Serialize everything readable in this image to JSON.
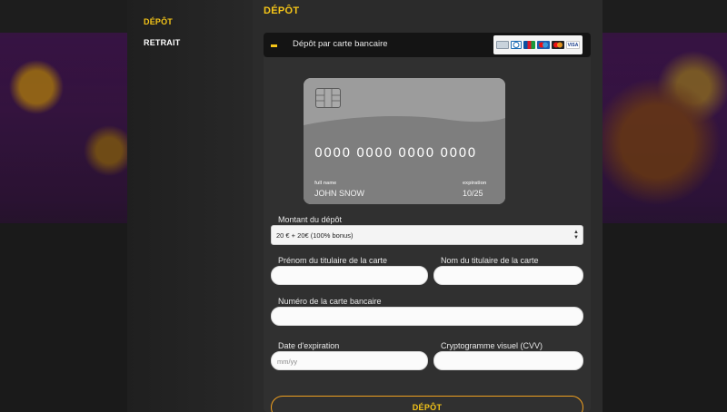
{
  "sidebar": {
    "items": [
      {
        "label": "DÉPÔT",
        "active": true
      },
      {
        "label": "RETRAIT",
        "active": false
      }
    ]
  },
  "main": {
    "title": "DÉPÔT",
    "method": {
      "label": "Dépôt par carte bancaire",
      "logos": [
        {
          "name": "generic-card-icon",
          "color": "#9aa7b4"
        },
        {
          "name": "diners-icon",
          "color": "#1a6bb3"
        },
        {
          "name": "jcb-icon",
          "color": "#0a4fa0"
        },
        {
          "name": "maestro-icon",
          "color": "#1c5fb0"
        },
        {
          "name": "mastercard-icon",
          "color": "#e8791a"
        },
        {
          "name": "visa-icon",
          "color": "#1a3e8c",
          "text": "VISA"
        }
      ]
    },
    "card": {
      "number": "0000 0000 0000 0000",
      "name_label": "full name",
      "name_value": "JOHN SNOW",
      "expiry_label": "expiration",
      "expiry_value": "10/25"
    },
    "form": {
      "amount_label": "Montant du dépôt",
      "amount_value": "20 € + 20€ (100% bonus)",
      "firstname_label": "Prénom du titulaire de la carte",
      "lastname_label": "Nom du titulaire de la carte",
      "cardnumber_label": "Numéro de la carte bancaire",
      "expiry_label": "Date d'expiration",
      "expiry_placeholder": "mm/yy",
      "cvv_label": "Cryptogramme visuel (CVV)",
      "submit_label": "DÉPÔT"
    }
  },
  "colors": {
    "accent": "#f5c518",
    "button_border": "#f0a020"
  }
}
